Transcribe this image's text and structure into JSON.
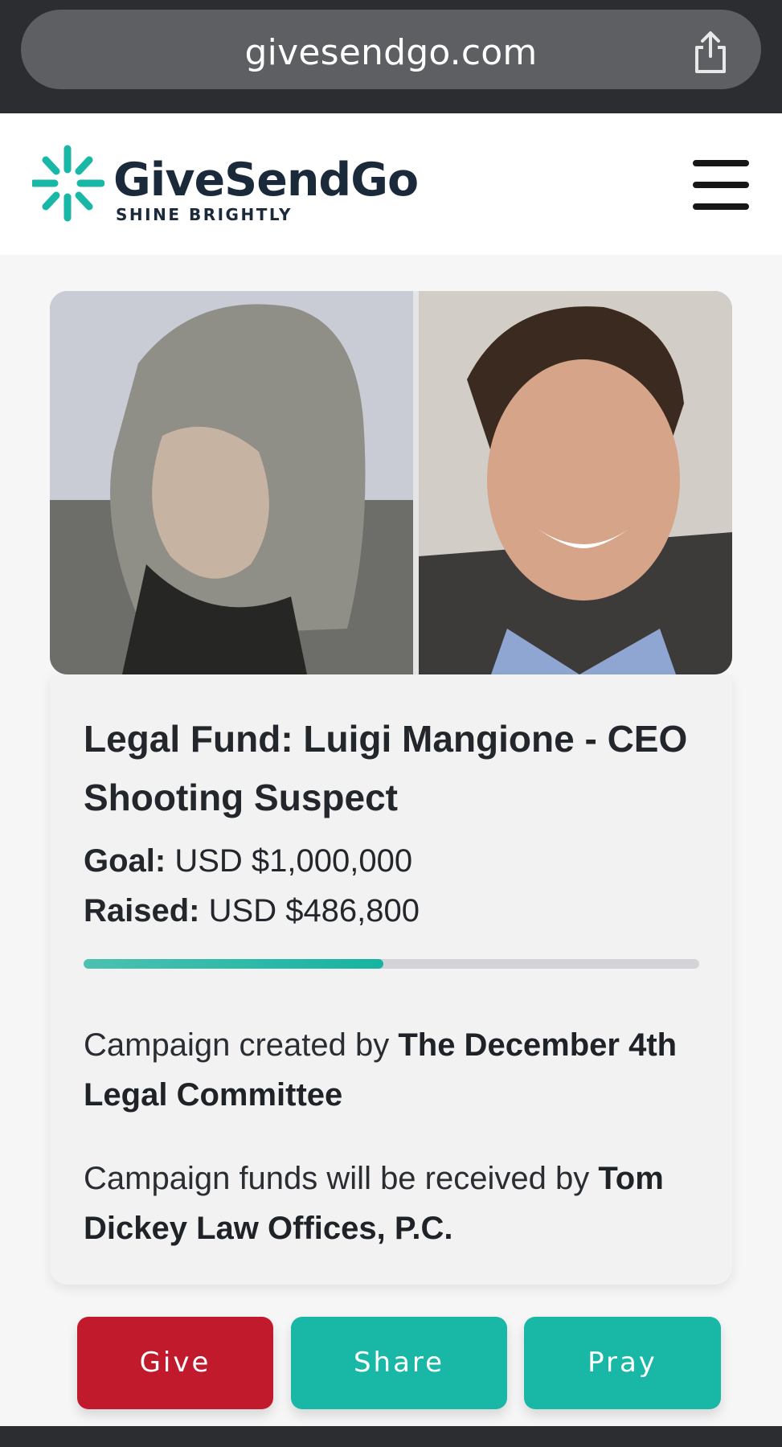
{
  "browser": {
    "url": "givesendgo.com",
    "share_icon": "share-icon"
  },
  "header": {
    "logo_title": "GiveSendGo",
    "logo_tagline": "SHINE BRIGHTLY",
    "menu_icon": "hamburger-menu-icon"
  },
  "campaign": {
    "title": "Legal Fund: Luigi Mangione - CEO Shooting Suspect",
    "goal_label": "Goal:",
    "goal_value": "USD $1,000,000",
    "raised_label": "Raised:",
    "raised_value": "USD $486,800",
    "progress_fraction": 0.4868,
    "created_by_text": "Campaign created by ",
    "created_by_name": "The December 4th Legal Committee",
    "received_by_text": "Campaign funds will be received by ",
    "received_by_name": "Tom Dickey Law Offices, P.C."
  },
  "actions": {
    "give": "Give",
    "share": "Share",
    "pray": "Pray"
  },
  "colors": {
    "brand_teal": "#19b7a6",
    "give_red": "#c01a2c",
    "dark_navy": "#1b2a3a"
  }
}
